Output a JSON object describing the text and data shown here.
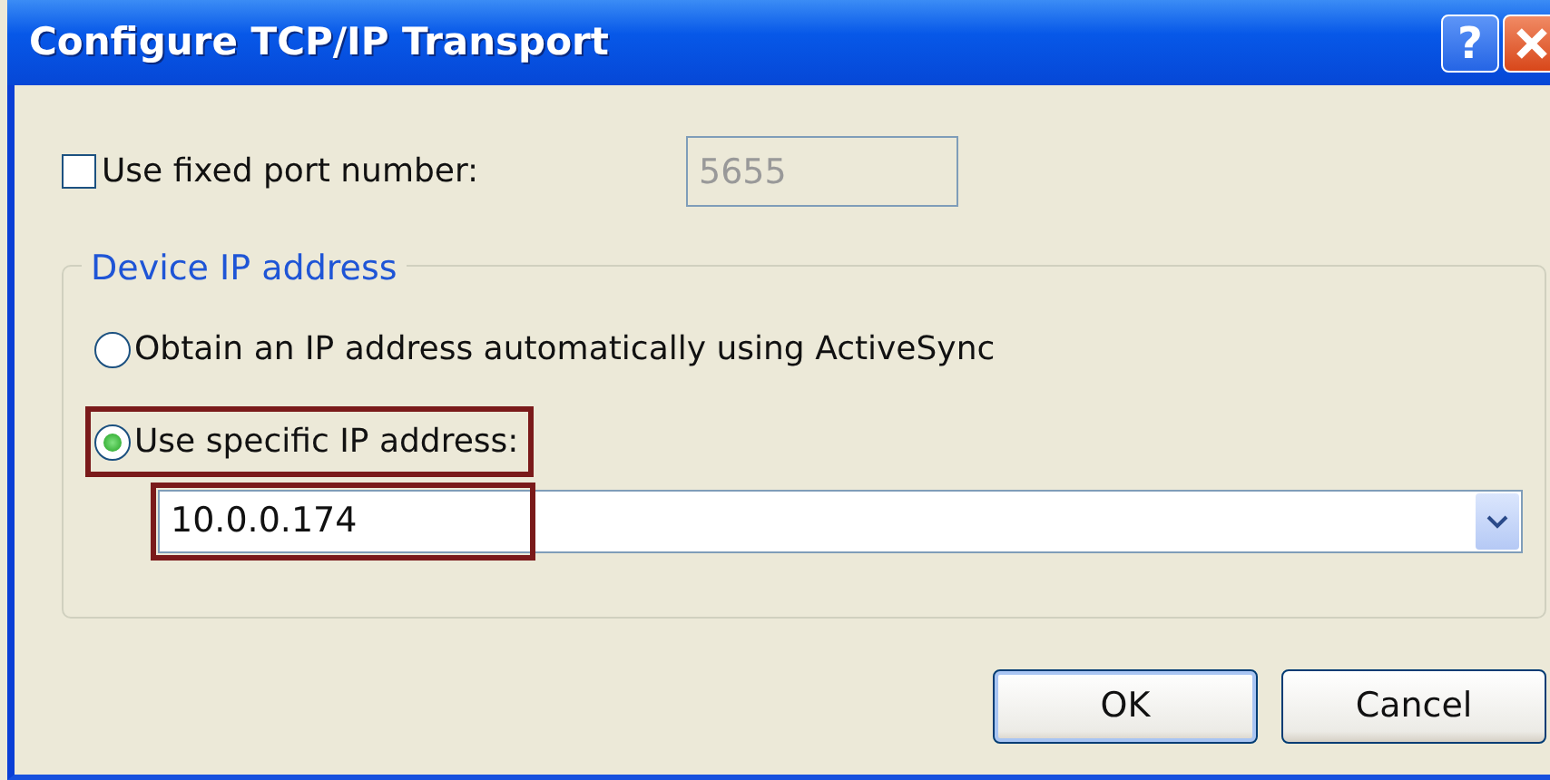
{
  "window": {
    "title": "Configure TCP/IP Transport",
    "help_button": "?"
  },
  "fixed_port": {
    "label": "Use fixed port number:",
    "checked": false,
    "value": "5655",
    "disabled": true
  },
  "group": {
    "legend": "Device IP address",
    "options": [
      {
        "label": "Obtain an IP address automatically using ActiveSync",
        "selected": false,
        "highlighted": false
      },
      {
        "label": "Use specific IP address:",
        "selected": true,
        "highlighted": true
      }
    ],
    "ip_combo": {
      "value": "10.0.0.174",
      "highlighted": true
    }
  },
  "buttons": [
    {
      "label": "OK",
      "default": true
    },
    {
      "label": "Cancel",
      "default": false
    }
  ]
}
